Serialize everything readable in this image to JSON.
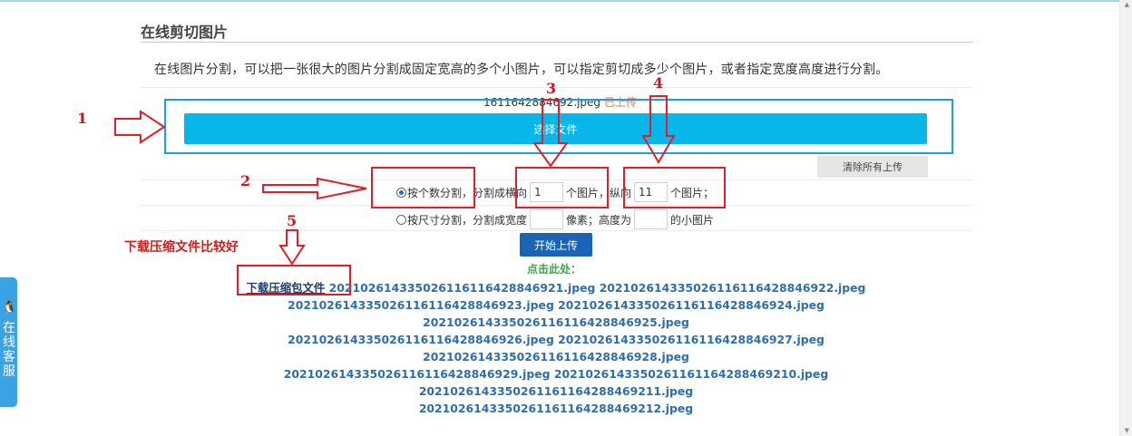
{
  "page": {
    "title": "在线剪切图片",
    "description": "在线图片分割，可以把一张很大的图片分割成固定宽高的多个小图片，可以指定剪切成多少个图片，或者指定宽度高度进行分割。"
  },
  "upload": {
    "file_name": "1611642884692.jpeg",
    "status": "已上传",
    "select_button": "选择文件",
    "clear_button": "清除所有上传"
  },
  "options": {
    "by_count": {
      "selected": true,
      "label": "按个数分割，",
      "horizontal_prefix": "分割成横向",
      "horizontal_value": "1",
      "horizontal_suffix": "个图片，纵向",
      "vertical_value": "11",
      "vertical_suffix": "个图片；"
    },
    "by_size": {
      "selected": false,
      "label": "按尺寸分割，",
      "width_prefix": "分割成宽度",
      "width_value": "",
      "width_suffix": "像素；高度为",
      "height_value": "",
      "height_suffix": "的小图片"
    }
  },
  "actions": {
    "start_upload": "开始上传",
    "click_here": "点击此处："
  },
  "downloads": {
    "zip_link": "下载压缩包文件",
    "files": [
      "202102614335026116116428846921.jpeg",
      "202102614335026116116428846922.jpeg",
      "202102614335026116116428846923.jpeg",
      "202102614335026116116428846924.jpeg",
      "202102614335026116116428846925.jpeg",
      "202102614335026116116428846926.jpeg",
      "202102614335026116116428846927.jpeg",
      "202102614335026116116428846928.jpeg",
      "202102614335026116116428846929.jpeg",
      "2021026143350261161164288469210.jpeg",
      "2021026143350261161164288469211.jpeg",
      "2021026143350261161164288469212.jpeg"
    ]
  },
  "customer_service": {
    "label": "在线客服"
  },
  "annotations": {
    "n1": "1",
    "n2": "2",
    "n3": "3",
    "n4": "4",
    "n5": "5",
    "note": "下载压缩文件比较好",
    "red": "#e11f2c",
    "blue": "#1aa0e0"
  },
  "colors": {
    "upload_button": "#09b6ea",
    "start_button": "#1b64b4",
    "link": "#2f6eaa",
    "status": "#f0a070",
    "click_here": "#41a24a"
  }
}
